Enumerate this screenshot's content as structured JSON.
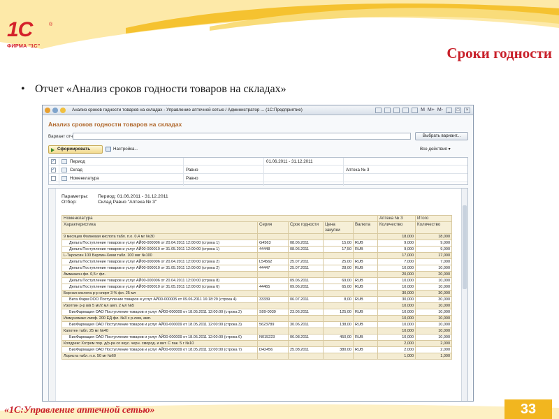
{
  "logo": {
    "main": "1С",
    "sub": "ФИРМА \"1С\"",
    "reg": "®"
  },
  "slide": {
    "title": "Сроки годности",
    "bullet_symbol": "•",
    "bullet_text": "Отчет  «Анализ сроков годности товаров на складах»",
    "footer": "«1С:Управление аптечной сетью»",
    "page_number": "33"
  },
  "window": {
    "title": "Анализ сроков годности товаров на складах - Управление аптечной сетью / Администратор ... (1С:Предприятие)",
    "controls": [
      "M",
      "M+",
      "M-",
      "_",
      "□",
      "×"
    ],
    "report_title": "Анализ сроков годности товаров на складах",
    "variant_label": "Вариант отчета:",
    "variant_value": "",
    "select_variant_button": "Выбрать вариант...",
    "run_button": "Сформировать",
    "settings_button": "Настройка...",
    "all_actions": "Все действия ▾",
    "params": [
      {
        "checked": "✓",
        "name": "Период",
        "condition": "",
        "value": "01.06.2011 - 31.12.2011",
        "value2": ""
      },
      {
        "checked": "✓",
        "name": "Склад",
        "condition": "Равно",
        "value": "",
        "value2": "Аптека № 3"
      },
      {
        "checked": "",
        "name": "Номенклатура",
        "condition": "Равно",
        "value": "",
        "value2": ""
      }
    ]
  },
  "report": {
    "params_label": "Параметры:",
    "params_value": "Период: 01.06.2011 - 31.12.2011",
    "filter_label": "Отбор:",
    "filter_value": "Склад Равно \"Аптека № 3\"",
    "header": {
      "nomenclature": "Номенклатура",
      "characteristic": "Характеристика",
      "series": "Серия",
      "expiry": "Срок годности",
      "price": "Цена закупки",
      "currency": "Валюта",
      "warehouse": "Аптека № 3",
      "total": "Итого",
      "qty": "Количество",
      "qty_total": "Количество"
    },
    "rows": [
      {
        "type": "grp",
        "name": "9 месяцев Фолиевая кислота табл. п.о. 0,4 мг №30",
        "series": "",
        "expiry": "",
        "price": "",
        "currency": "",
        "qty": "18,000",
        "total": "18,000"
      },
      {
        "type": "doc",
        "name": "Дельта Поступление товаров и услуг АЙ00-000006 от 20.04.2011 12:00:00 (строка 1)",
        "series": "G4563",
        "expiry": "08.06.2011",
        "price": "15,00",
        "currency": "RUB",
        "qty": "9,000",
        "total": "9,000"
      },
      {
        "type": "doc",
        "name": "Дельта Поступление товаров и услуг АЙ00-000010 от 31.05.2011 12:00:00 (строка 1)",
        "series": "44448",
        "expiry": "08.06.2011",
        "price": "17,50",
        "currency": "RUB",
        "qty": "9,000",
        "total": "9,000"
      },
      {
        "type": "grp",
        "name": "L-Тироксин 100 Берлин-Хеми табл. 100 мкг №100",
        "series": "",
        "expiry": "",
        "price": "",
        "currency": "",
        "qty": "17,000",
        "total": "17,000"
      },
      {
        "type": "doc",
        "name": "Дельта Поступление товаров и услуг АЙ00-000006 от 20.04.2011 12:00:00 (строка 2)",
        "series": "L54562",
        "expiry": "25.07.2011",
        "price": "25,00",
        "currency": "RUB",
        "qty": "7,000",
        "total": "7,000"
      },
      {
        "type": "doc",
        "name": "Дельта Поступление товаров и услуг АЙ00-000010 от 31.05.2011 12:00:00 (строка 2)",
        "series": "44447",
        "expiry": "25.07.2011",
        "price": "28,00",
        "currency": "RUB",
        "qty": "10,000",
        "total": "10,000"
      },
      {
        "type": "grp",
        "name": "Аммиакон фл. 0,5 г фл.",
        "series": "",
        "expiry": "",
        "price": "",
        "currency": "",
        "qty": "20,000",
        "total": "20,000"
      },
      {
        "type": "doc",
        "name": "Дельта Поступление товаров и услуг АЙ00-000006 от 20.04.2011 12:00:00 (строка 8)",
        "series": "",
        "expiry": "09.06.2011",
        "price": "69,00",
        "currency": "RUB",
        "qty": "10,000",
        "total": "10,000"
      },
      {
        "type": "doc",
        "name": "Дельта Поступление товаров и услуг АЙ00-000010 от 31.05.2011 12:00:00 (строка 6)",
        "series": "44465",
        "expiry": "09.06.2011",
        "price": "65,00",
        "currency": "RUB",
        "qty": "10,000",
        "total": "10,000"
      },
      {
        "type": "grp",
        "name": "Борная кислота р-р спирт 3 % фл. 25 мл",
        "series": "",
        "expiry": "",
        "price": "",
        "currency": "",
        "qty": "30,000",
        "total": "30,000"
      },
      {
        "type": "doc2",
        "name": "Вита Фарм ООО Поступление товаров и услуг АЙ00-000005 от 09.06.2011 16:18:29 (строка 4)",
        "series": "33339",
        "expiry": "06.07.2011",
        "price": "8,00",
        "currency": "RUB",
        "qty": "30,000",
        "total": "30,000"
      },
      {
        "type": "grp",
        "name": "Изоптин р-р в/в 5 мг/2 мл амп. 2 мл №5",
        "series": "",
        "expiry": "",
        "price": "",
        "currency": "",
        "qty": "10,000",
        "total": "10,000"
      },
      {
        "type": "doc2",
        "name": "БиоФармация ОАО Поступление товаров и услуг АЙ00-000009 от 18.05.2011 12:00:00 (строка 2)",
        "series": "S09-0039",
        "expiry": "23.06.2011",
        "price": "125,00",
        "currency": "RUB",
        "qty": "10,000",
        "total": "10,000"
      },
      {
        "type": "grp",
        "name": "Иммуномакс лиоф. 200 ЕД фл. №3 с р-лем, амп.",
        "series": "",
        "expiry": "",
        "price": "",
        "currency": "",
        "qty": "10,000",
        "total": "10,000"
      },
      {
        "type": "doc2",
        "name": "БиоФармация ОАО Поступление товаров и услуг АЙ00-000009 от 18.05.2011 12:00:00 (строка 3)",
        "series": "5623789",
        "expiry": "30.06.2011",
        "price": "138,00",
        "currency": "RUB",
        "qty": "10,000",
        "total": "10,000"
      },
      {
        "type": "grp",
        "name": "Капотен табл. 25 мг №40",
        "series": "",
        "expiry": "",
        "price": "",
        "currency": "",
        "qty": "10,000",
        "total": "10,000"
      },
      {
        "type": "doc2",
        "name": "БиоФармация ОАО Поступление товаров и услуг АЙ00-000009 от 18.05.2011 12:00:00 (строка 6)",
        "series": "N015223",
        "expiry": "06.08.2011",
        "price": "450,00",
        "currency": "RUB",
        "qty": "10,000",
        "total": "10,000"
      },
      {
        "type": "grp",
        "name": "Колдрекс Хотрем пор. д/р-ра со вкус. черн. смород. и вит. С пак. 5 г №10",
        "series": "",
        "expiry": "",
        "price": "",
        "currency": "",
        "qty": "2,000",
        "total": "2,000"
      },
      {
        "type": "doc2",
        "name": "БиоФармация ОАО Поступление товаров и услуг АЙ00-000009 от 18.05.2011 12:00:00 (строка 7)",
        "series": "D42456",
        "expiry": "25.08.2011",
        "price": "380,00",
        "currency": "RUB",
        "qty": "2,000",
        "total": "2,000"
      },
      {
        "type": "grp",
        "name": "Лориста табл. п.о. 50 мг №60",
        "series": "",
        "expiry": "",
        "price": "",
        "currency": "",
        "qty": "1,000",
        "total": "1,000"
      }
    ]
  },
  "colors": {
    "accent_red": "#c8202a",
    "gold": "#f2b61f",
    "report_title": "#b0682c"
  }
}
